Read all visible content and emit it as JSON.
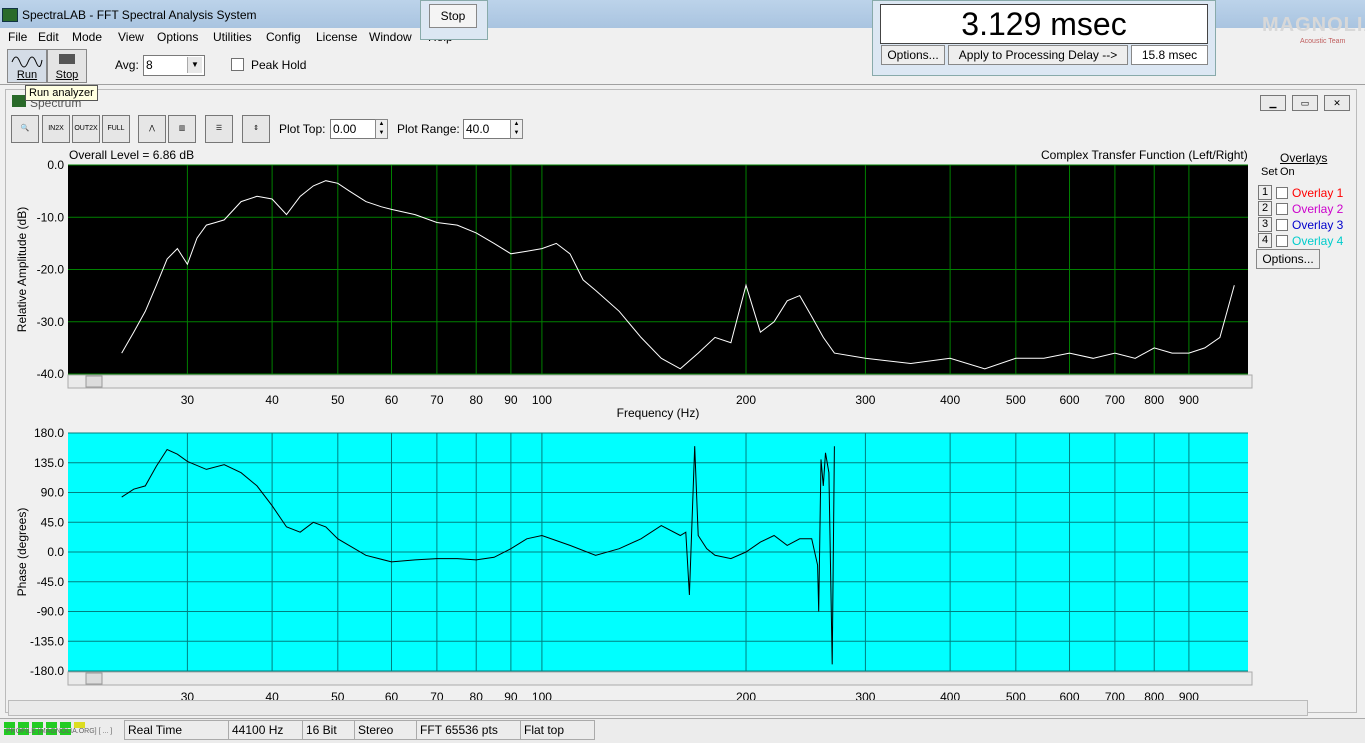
{
  "app": {
    "title": "SpectraLAB - FFT Spectral Analysis System"
  },
  "menu": [
    "File",
    "Edit",
    "Mode",
    "View",
    "Options",
    "Utilities",
    "Config",
    "License",
    "Window",
    "Help"
  ],
  "toolbar": {
    "run_label": "Run",
    "stop_label": "Stop",
    "avg_label": "Avg:",
    "avg_value": "8",
    "peak_hold_label": "Peak Hold"
  },
  "tooltip": "Run analyzer",
  "stop_window": {
    "button": "Stop"
  },
  "delay_window": {
    "readout": "3.129 msec",
    "options": "Options...",
    "apply": "Apply to Processing Delay -->",
    "value": "15.8 msec"
  },
  "logo": {
    "text": "MAGNOLIA",
    "sub": "Acoustic Team"
  },
  "spectrum": {
    "window_title": "Spectrum",
    "plot_top_label": "Plot Top:",
    "plot_top_value": "0.00",
    "plot_range_label": "Plot Range:",
    "plot_range_value": "40.0",
    "overall_level": "Overall Level = 6.86 dB",
    "function_label": "Complex Transfer Function (Left/Right)"
  },
  "overlays": {
    "title": "Overlays",
    "set_label": "Set",
    "on_label": "On",
    "items": [
      {
        "num": "1",
        "label": "Overlay 1",
        "color": "#ff0000"
      },
      {
        "num": "2",
        "label": "Overlay 2",
        "color": "#cc00cc"
      },
      {
        "num": "3",
        "label": "Overlay 3",
        "color": "#0000cc"
      },
      {
        "num": "4",
        "label": "Overlay 4",
        "color": "#00cccc"
      }
    ],
    "options": "Options..."
  },
  "status": {
    "mode": "Real Time",
    "rate": "44100 Hz",
    "bits": "16 Bit",
    "channels": "Stereo",
    "fft": "FFT 65536 pts",
    "window": "Flat top",
    "meter_caption": "PROFILE [MAGNOLIA.ORG] [ ... ]"
  },
  "colors": {
    "amp_bg": "#000000",
    "amp_grid": "#008000",
    "amp_trace": "#ffffff",
    "phase_bg": "#00ffff",
    "phase_grid": "#008080",
    "phase_trace": "#000000"
  },
  "chart_data": [
    {
      "type": "line",
      "xlabel": "Frequency (Hz)",
      "ylabel": "Relative Amplitude (dB)",
      "xscale": "log",
      "xlim": [
        20,
        1100
      ],
      "ylim": [
        -40,
        0
      ],
      "grid": true,
      "yticks": [
        "0.0",
        "-10.0",
        "-20.0",
        "-30.0",
        "-40.0"
      ],
      "xticks": [
        "30",
        "40",
        "50",
        "60",
        "70",
        "80",
        "90",
        "100",
        "200",
        "300",
        "400",
        "500",
        "600",
        "700",
        "800",
        "900"
      ],
      "x": [
        24,
        25,
        26,
        27,
        28,
        29,
        30,
        31,
        32,
        33,
        34,
        36,
        38,
        40,
        42,
        44,
        46,
        48,
        50,
        52,
        55,
        58,
        60,
        65,
        70,
        75,
        80,
        85,
        90,
        95,
        100,
        105,
        110,
        115,
        120,
        130,
        140,
        150,
        160,
        170,
        180,
        190,
        200,
        210,
        220,
        230,
        240,
        250,
        260,
        270,
        300,
        350,
        400,
        450,
        500,
        550,
        600,
        650,
        700,
        750,
        800,
        850,
        900,
        950,
        1000,
        1050
      ],
      "y": [
        -36,
        -32,
        -28,
        -23,
        -18,
        -16,
        -19,
        -14,
        -11.5,
        -11,
        -10.5,
        -7,
        -6,
        -6.5,
        -9.5,
        -6,
        -4,
        -3,
        -3.5,
        -5,
        -7,
        -8,
        -8.5,
        -9.5,
        -11,
        -11.5,
        -13,
        -15,
        -17,
        -16.5,
        -16,
        -15,
        -17,
        -22,
        -24,
        -28,
        -33,
        -37,
        -39,
        -36,
        -33,
        -34,
        -23,
        -32,
        -30,
        -26,
        -25,
        -29,
        -33,
        -36,
        -37,
        -38,
        -37,
        -39,
        -37,
        -37,
        -36,
        -37,
        -36,
        -37,
        -35,
        -36,
        -36,
        -35,
        -33,
        -23
      ]
    },
    {
      "type": "line",
      "xlabel": "",
      "ylabel": "Phase (degrees)",
      "xscale": "log",
      "xlim": [
        20,
        1100
      ],
      "ylim": [
        -180,
        180
      ],
      "grid": true,
      "yticks": [
        "180.0",
        "135.0",
        "90.0",
        "45.0",
        "0.0",
        "-45.0",
        "-90.0",
        "-135.0",
        "-180.0"
      ],
      "xticks": [
        "30",
        "40",
        "50",
        "60",
        "70",
        "80",
        "90",
        "100",
        "200",
        "300",
        "400",
        "500",
        "600",
        "700",
        "800",
        "900"
      ],
      "x": [
        24,
        25,
        26,
        27,
        28,
        29,
        30,
        32,
        34,
        36,
        38,
        40,
        42,
        44,
        46,
        48,
        50,
        55,
        60,
        65,
        70,
        75,
        80,
        85,
        90,
        95,
        100,
        110,
        120,
        130,
        140,
        150,
        160,
        163,
        165,
        168,
        170,
        175,
        180,
        190,
        200,
        210,
        220,
        230,
        240,
        250,
        255,
        256,
        258,
        260,
        262,
        265,
        268,
        270
      ],
      "y": [
        83,
        95,
        100,
        130,
        155,
        148,
        137,
        125,
        132,
        120,
        100,
        70,
        38,
        30,
        45,
        38,
        20,
        -5,
        -15,
        -12,
        -10,
        -10,
        -12,
        -8,
        5,
        20,
        25,
        10,
        -5,
        5,
        20,
        40,
        25,
        30,
        -65,
        160,
        25,
        5,
        -5,
        -10,
        0,
        15,
        25,
        10,
        20,
        20,
        -20,
        -90,
        140,
        100,
        150,
        120,
        -170,
        160
      ]
    }
  ]
}
